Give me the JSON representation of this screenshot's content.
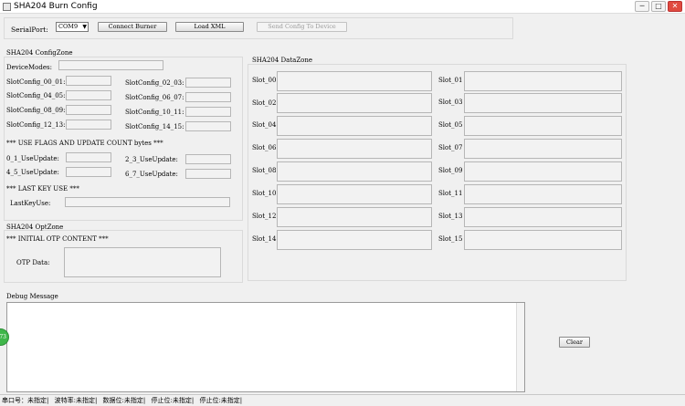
{
  "window": {
    "title": "SHA204 Burn Config",
    "minimize_glyph": "─",
    "maximize_glyph": "□",
    "close_glyph": "✕"
  },
  "toolbar": {
    "serial_port_label": "SerialPort:",
    "serial_port_value": "COM9",
    "combo_arrow": "▼",
    "connect_label": "Connect Burner",
    "load_xml_label": "Load XML",
    "send_label": "Send Config To Device"
  },
  "config_zone": {
    "title": "SHA204 ConfigZone",
    "device_modes_label": "DeviceModes:",
    "slot_configs": [
      "SlotConfig_00_01:",
      "SlotConfig_02_03:",
      "SlotConfig_04_05:",
      "SlotConfig_06_07:",
      "SlotConfig_08_09:",
      "SlotConfig_10_11:",
      "SlotConfig_12_13:",
      "SlotConfig_14_15:"
    ],
    "use_flags_header": "*** USE FLAGS AND UPDATE COUNT bytes ***",
    "use_updates": [
      "0_1_UseUpdate:",
      "2_3_UseUpdate:",
      "4_5_UseUpdate:",
      "6_7_UseUpdate:"
    ],
    "last_key_header": "*** LAST KEY USE ***",
    "last_key_label": "LastKeyUse:"
  },
  "otp_zone": {
    "title": "SHA204 OptZone",
    "initial_header": "*** INITIAL OTP CONTENT ***",
    "otp_label": "OTP Data:"
  },
  "data_zone": {
    "title": "SHA204 DataZone",
    "slots": [
      "Slot_00",
      "Slot_01",
      "Slot_02",
      "Slot_03",
      "Slot_04",
      "Slot_05",
      "Slot_06",
      "Slot_07",
      "Slot_08",
      "Slot_09",
      "Slot_10",
      "Slot_11",
      "Slot_12",
      "Slot_13",
      "Slot_14",
      "Slot_15"
    ]
  },
  "debug": {
    "title": "Debug Message",
    "clear_label": "Clear"
  },
  "statusbar": {
    "items": [
      "串口号：未指定|",
      "波特率:未指定|",
      "数据位:未指定|",
      "停止位:未指定|",
      "停止位:未指定|"
    ]
  },
  "side_widget_label": "73"
}
